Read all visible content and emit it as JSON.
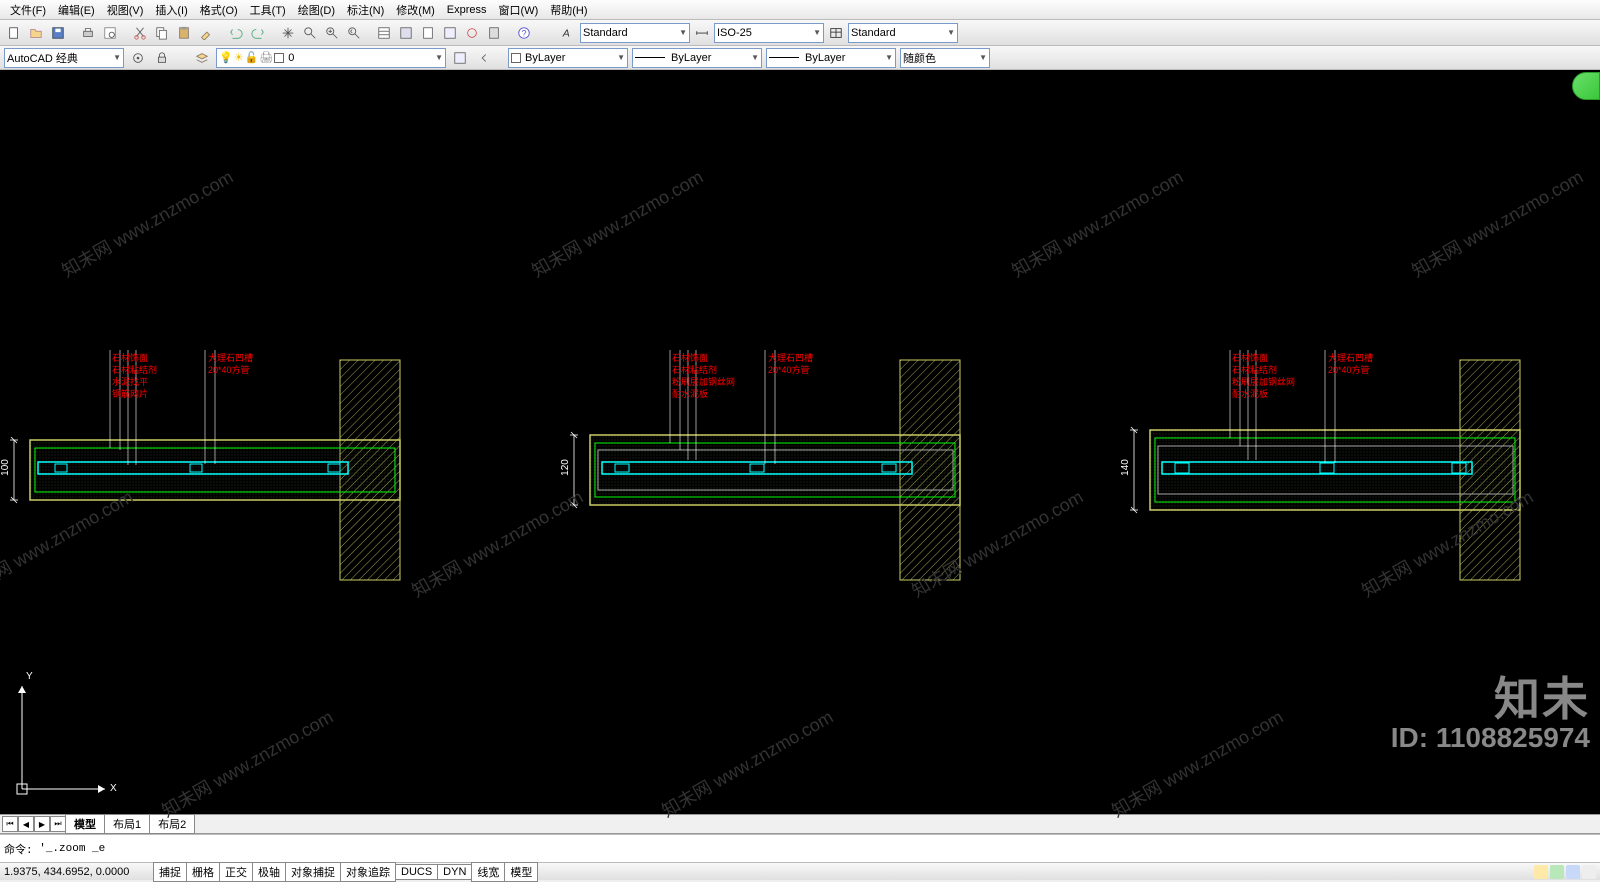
{
  "menu": {
    "items": [
      "文件(F)",
      "编辑(E)",
      "视图(V)",
      "插入(I)",
      "格式(O)",
      "工具(T)",
      "绘图(D)",
      "标注(N)",
      "修改(M)",
      "Express",
      "窗口(W)",
      "帮助(H)"
    ]
  },
  "workspace": {
    "label": "AutoCAD 经典"
  },
  "toolbar1": {
    "textstyle": "Standard",
    "dimstyle": "ISO-25",
    "tablestyle": "Standard"
  },
  "toolbar2": {
    "layer": "0",
    "color": "ByLayer",
    "linetype": "ByLayer",
    "lineweight": "ByLayer",
    "plotstyle": "随颜色"
  },
  "tabs": {
    "items": [
      "模型",
      "布局1",
      "布局2"
    ],
    "active": 0
  },
  "cmd": {
    "prompt": "命令:",
    "text": "'_.zoom _e"
  },
  "status": {
    "coords": "1.9375, 434.6952, 0.0000",
    "buttons": [
      "捕捉",
      "栅格",
      "正交",
      "极轴",
      "对象捕捉",
      "对象追踪",
      "DUCS",
      "DYN",
      "线宽",
      "模型"
    ]
  },
  "sections": [
    {
      "dim": "100",
      "left_labels": [
        "石材饰面",
        "石材粘结剂",
        "水泥找平",
        "钢筋网片"
      ],
      "right_labels": [
        "大理石凹槽",
        "20*40方管"
      ]
    },
    {
      "dim": "120",
      "left_labels": [
        "石材饰面",
        "石材粘结剂",
        "粉刷层加钢丝网",
        "耐水泥板"
      ],
      "right_labels": [
        "大理石凹槽",
        "20*40方管"
      ]
    },
    {
      "dim": "140",
      "left_labels": [
        "石材饰面",
        "石材粘结剂",
        "粉刷层加钢丝网",
        "耐水泥板"
      ],
      "right_labels": [
        "大理石凹槽",
        "20*40方管"
      ]
    }
  ],
  "watermark": {
    "text": "知未网 www.znzmo.com",
    "brand": "知未",
    "id": "ID: 1108825974"
  },
  "ucs": {
    "x": "X",
    "y": "Y"
  }
}
